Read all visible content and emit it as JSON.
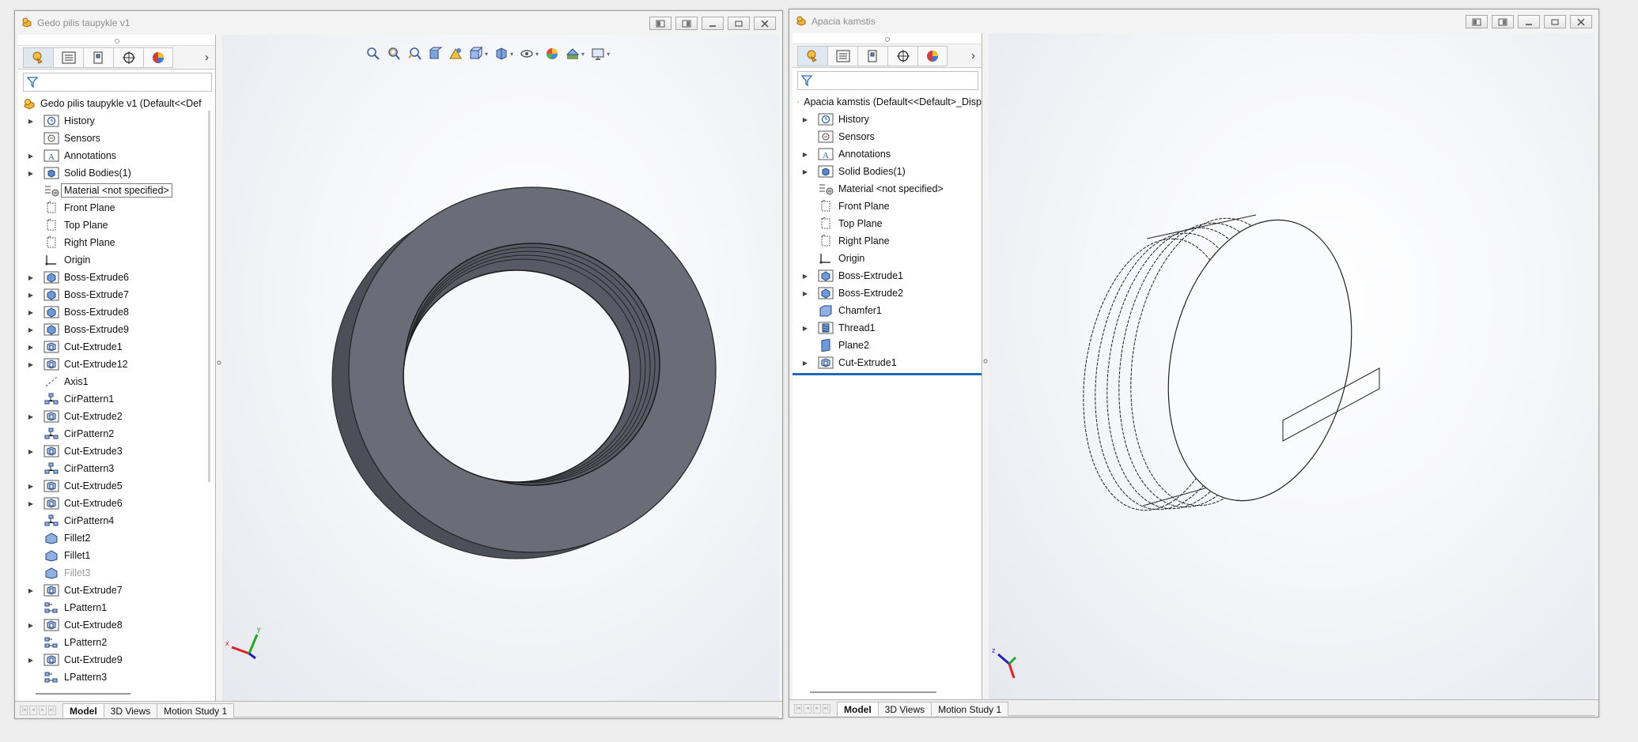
{
  "windows": [
    {
      "title": "Gedo pilis taupykle v1",
      "root_label": "Gedo pilis taupykle v1  (Default<<Def",
      "nodes": [
        {
          "label": "History",
          "icon": "history-icon",
          "expandable": true
        },
        {
          "label": "Sensors",
          "icon": "sensors-icon",
          "expandable": false
        },
        {
          "label": "Annotations",
          "icon": "annotations-icon",
          "expandable": true
        },
        {
          "label": "Solid Bodies(1)",
          "icon": "solid-bodies-icon",
          "expandable": true
        },
        {
          "label": "Material <not specified>",
          "icon": "material-icon",
          "expandable": false,
          "boxed": true
        },
        {
          "label": "Front Plane",
          "icon": "plane-icon",
          "expandable": false
        },
        {
          "label": "Top Plane",
          "icon": "plane-icon",
          "expandable": false
        },
        {
          "label": "Right Plane",
          "icon": "plane-icon",
          "expandable": false
        },
        {
          "label": "Origin",
          "icon": "origin-icon",
          "expandable": false
        },
        {
          "label": "Boss-Extrude6",
          "icon": "boss-extrude-icon",
          "expandable": true
        },
        {
          "label": "Boss-Extrude7",
          "icon": "boss-extrude-icon",
          "expandable": true
        },
        {
          "label": "Boss-Extrude8",
          "icon": "boss-extrude-icon",
          "expandable": true
        },
        {
          "label": "Boss-Extrude9",
          "icon": "boss-extrude-icon",
          "expandable": true
        },
        {
          "label": "Cut-Extrude1",
          "icon": "cut-extrude-icon",
          "expandable": true
        },
        {
          "label": "Cut-Extrude12",
          "icon": "cut-extrude-icon",
          "expandable": true
        },
        {
          "label": "Axis1",
          "icon": "axis-icon",
          "expandable": false
        },
        {
          "label": "CirPattern1",
          "icon": "cir-pattern-icon",
          "expandable": false
        },
        {
          "label": "Cut-Extrude2",
          "icon": "cut-extrude-icon",
          "expandable": true
        },
        {
          "label": "CirPattern2",
          "icon": "cir-pattern-icon",
          "expandable": false
        },
        {
          "label": "Cut-Extrude3",
          "icon": "cut-extrude-icon",
          "expandable": true
        },
        {
          "label": "CirPattern3",
          "icon": "cir-pattern-icon",
          "expandable": false
        },
        {
          "label": "Cut-Extrude5",
          "icon": "cut-extrude-icon",
          "expandable": true
        },
        {
          "label": "Cut-Extrude6",
          "icon": "cut-extrude-icon",
          "expandable": true
        },
        {
          "label": "CirPattern4",
          "icon": "cir-pattern-icon",
          "expandable": false
        },
        {
          "label": "Fillet2",
          "icon": "fillet-icon",
          "expandable": false
        },
        {
          "label": "Fillet1",
          "icon": "fillet-icon",
          "expandable": false
        },
        {
          "label": "Fillet3",
          "icon": "fillet-icon",
          "expandable": false,
          "dim": true
        },
        {
          "label": "Cut-Extrude7",
          "icon": "cut-extrude-icon",
          "expandable": true
        },
        {
          "label": "LPattern1",
          "icon": "linear-pattern-icon",
          "expandable": false
        },
        {
          "label": "Cut-Extrude8",
          "icon": "cut-extrude-icon",
          "expandable": true
        },
        {
          "label": "LPattern2",
          "icon": "linear-pattern-icon",
          "expandable": false
        },
        {
          "label": "Cut-Extrude9",
          "icon": "cut-extrude-icon",
          "expandable": true
        },
        {
          "label": "LPattern3",
          "icon": "linear-pattern-icon",
          "expandable": false
        }
      ],
      "bottom_tabs": [
        "Model",
        "3D Views",
        "Motion Study 1"
      ]
    },
    {
      "title": "Apacia kamstis",
      "root_label": "Apacia kamstis  (Default<<Default>_Disp",
      "nodes": [
        {
          "label": "History",
          "icon": "history-icon",
          "expandable": true
        },
        {
          "label": "Sensors",
          "icon": "sensors-icon",
          "expandable": false
        },
        {
          "label": "Annotations",
          "icon": "annotations-icon",
          "expandable": true
        },
        {
          "label": "Solid Bodies(1)",
          "icon": "solid-bodies-icon",
          "expandable": true
        },
        {
          "label": "Material <not specified>",
          "icon": "material-icon",
          "expandable": false
        },
        {
          "label": "Front Plane",
          "icon": "plane-icon",
          "expandable": false
        },
        {
          "label": "Top Plane",
          "icon": "plane-icon",
          "expandable": false
        },
        {
          "label": "Right Plane",
          "icon": "plane-icon",
          "expandable": false
        },
        {
          "label": "Origin",
          "icon": "origin-icon",
          "expandable": false
        },
        {
          "label": "Boss-Extrude1",
          "icon": "boss-extrude-icon",
          "expandable": true
        },
        {
          "label": "Boss-Extrude2",
          "icon": "boss-extrude-icon",
          "expandable": true
        },
        {
          "label": "Chamfer1",
          "icon": "chamfer-icon",
          "expandable": false
        },
        {
          "label": "Thread1",
          "icon": "thread-icon",
          "expandable": true
        },
        {
          "label": "Plane2",
          "icon": "plane2-icon",
          "expandable": false
        },
        {
          "label": "Cut-Extrude1",
          "icon": "cut-extrude-icon",
          "expandable": true
        }
      ],
      "bottom_tabs": [
        "Model",
        "3D Views",
        "Motion Study 1"
      ]
    }
  ],
  "colors": {
    "rollback_bar": "#1e6bb8",
    "ring_face": "#6b6e79",
    "ring_side": "#4f525b"
  }
}
